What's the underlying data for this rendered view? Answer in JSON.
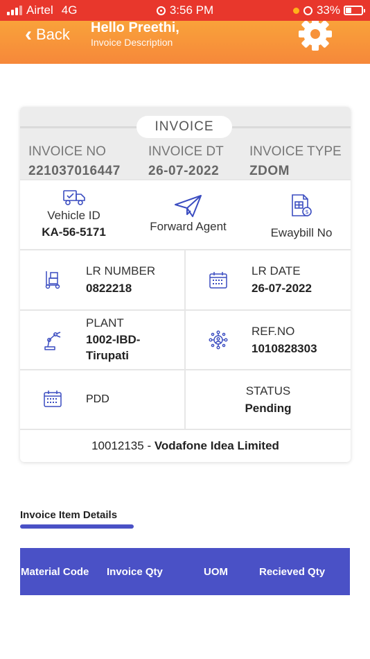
{
  "status_bar": {
    "carrier": "Airtel",
    "network": "4G",
    "time": "3:56 PM",
    "battery": "33%"
  },
  "header": {
    "back_label": "Back",
    "greeting": "Hello Preethi,",
    "subtitle": "Invoice Description",
    "settings_icon": "gear-icon",
    "gradient": [
      "#f9a23a",
      "#f6883a"
    ]
  },
  "invoice": {
    "title": "INVOICE",
    "invoice_no_label": "INVOICE NO",
    "invoice_no": "221037016447",
    "invoice_dt_label": "INVOICE DT",
    "invoice_dt": "26-07-2022",
    "invoice_type_label": "INVOICE TYPE",
    "invoice_type": "ZDOM",
    "vehicle_id_label": "Vehicle ID",
    "vehicle_id": "KA-56-5171",
    "forward_agent_label": "Forward Agent",
    "eway_bill_label": "Ewaybill No",
    "lr_number_label": "LR NUMBER",
    "lr_number": "0822218",
    "lr_date_label": "LR DATE",
    "lr_date": "26-07-2022",
    "plant_label": "PLANT",
    "plant_line1": "1002-IBD-",
    "plant_line2": "Tirupati",
    "ref_no_label": "REF.NO",
    "ref_no": "1010828303",
    "pdd_label": "PDD",
    "status_label": "STATUS",
    "status": "Pending",
    "customer_code": "10012135",
    "customer_sep": " - ",
    "customer_name": "Vodafone Idea Limited"
  },
  "items": {
    "section_title": "Invoice Item Details",
    "columns": [
      "Material Code",
      "Invoice Qty",
      "UOM",
      "Recieved Qty"
    ]
  },
  "colors": {
    "status_bar": "#e8372c",
    "accent": "#4a51c6",
    "icon": "#3a4cc0"
  }
}
